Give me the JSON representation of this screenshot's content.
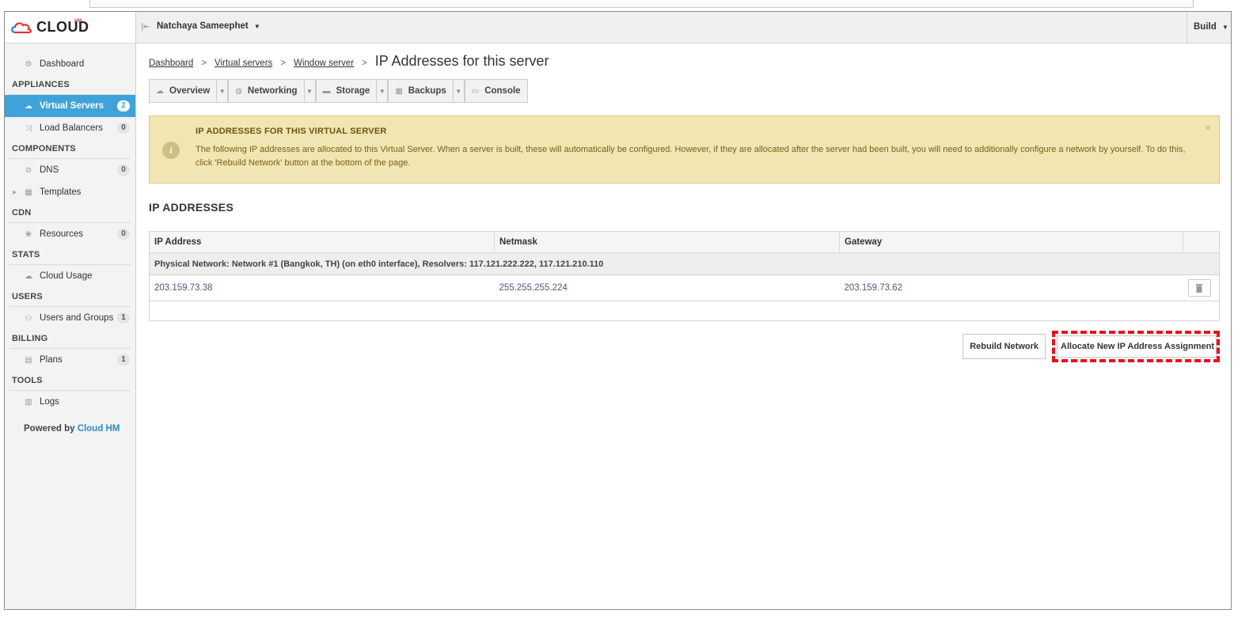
{
  "brand": {
    "name": "CLOUD",
    "superscript": "HM"
  },
  "header": {
    "user": "Natchaya Sameephet",
    "build": "Build"
  },
  "sidebar": {
    "items": [
      {
        "type": "item",
        "label": "Dashboard",
        "icon": "dashboard-icon"
      },
      {
        "type": "section",
        "label": "APPLIANCES"
      },
      {
        "type": "item",
        "label": "Virtual Servers",
        "badge": "2",
        "active": true,
        "icon": "cloud-icon"
      },
      {
        "type": "item",
        "label": "Load Balancers",
        "badge": "0",
        "icon": "shuffle-icon"
      },
      {
        "type": "section",
        "label": "COMPONENTS"
      },
      {
        "type": "item",
        "label": "DNS",
        "badge": "0",
        "icon": "dns-icon"
      },
      {
        "type": "item",
        "label": "Templates",
        "icon": "templates-icon",
        "expandable": true
      },
      {
        "type": "section",
        "label": "CDN"
      },
      {
        "type": "item",
        "label": "Resources",
        "badge": "0",
        "icon": "resources-icon"
      },
      {
        "type": "section",
        "label": "STATS"
      },
      {
        "type": "item",
        "label": "Cloud Usage",
        "icon": "cloud-usage-icon"
      },
      {
        "type": "section",
        "label": "USERS"
      },
      {
        "type": "item",
        "label": "Users and Groups",
        "badge": "1",
        "icon": "users-icon"
      },
      {
        "type": "section",
        "label": "BILLING"
      },
      {
        "type": "item",
        "label": "Plans",
        "badge": "1",
        "icon": "plans-icon"
      },
      {
        "type": "section",
        "label": "TOOLS"
      },
      {
        "type": "item",
        "label": "Logs",
        "icon": "logs-icon"
      }
    ],
    "powered_by": "Powered by",
    "powered_brand": "Cloud HM"
  },
  "breadcrumb": {
    "links": [
      "Dashboard",
      "Virtual servers",
      "Window server"
    ],
    "current": "IP Addresses for this server"
  },
  "tabs": {
    "overview": "Overview",
    "networking": "Networking",
    "storage": "Storage",
    "backups": "Backups",
    "console": "Console"
  },
  "alert": {
    "title": "IP ADDRESSES FOR THIS VIRTUAL SERVER",
    "text": "The following IP addresses are allocated to this Virtual Server. When a server is built, these will automatically be configured. However, if they are allocated after the server had been built, you will need to additionally configure a network by yourself. To do this, click 'Rebuild Network' button at the bottom of the page."
  },
  "section_title": "IP ADDRESSES",
  "table": {
    "columns": [
      "IP Address",
      "Netmask",
      "Gateway"
    ],
    "group": "Physical Network: Network #1 (Bangkok, TH) (on eth0 interface), Resolvers: 117.121.222.222, 117.121.210.110",
    "rows": [
      {
        "ip": "203.159.73.38",
        "netmask": "255.255.255.224",
        "gateway": "203.159.73.62"
      }
    ]
  },
  "actions": {
    "rebuild": "Rebuild Network",
    "allocate": "Allocate New IP Address Assignment"
  },
  "colors": {
    "accent": "#3fa3d9",
    "alert_bg": "#f1e6b3",
    "highlight": "#e8121b"
  }
}
